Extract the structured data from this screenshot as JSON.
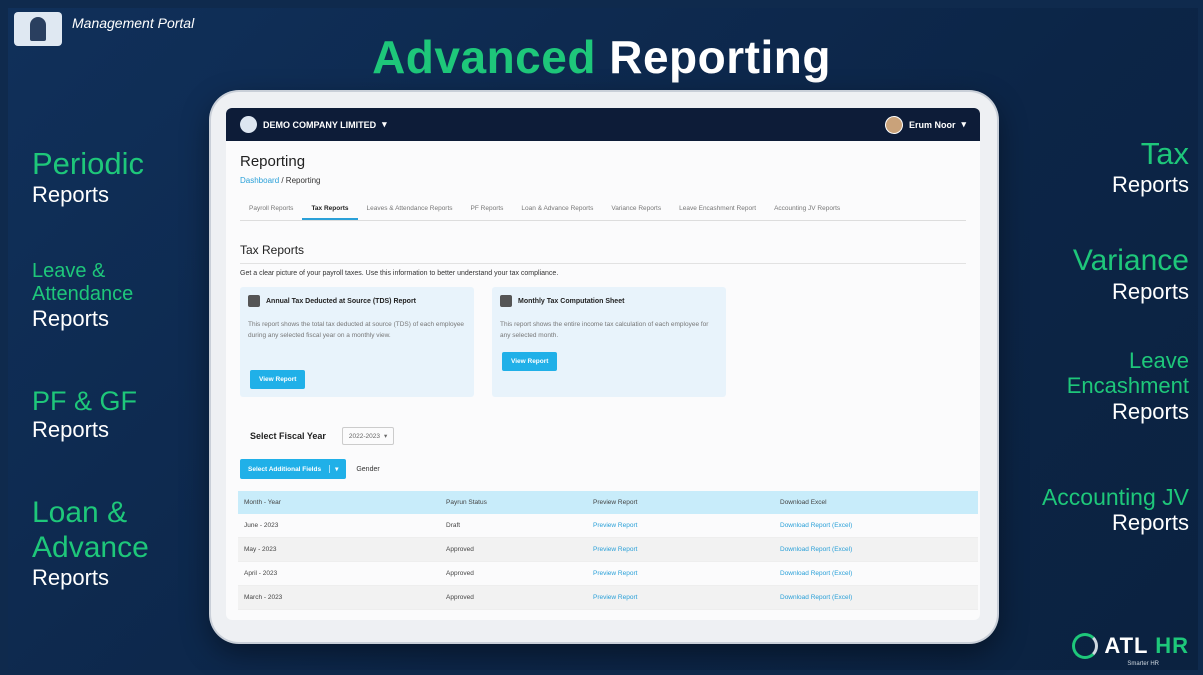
{
  "header": {
    "portal_label": "Management Portal",
    "title_green": "Advanced",
    "title_white": "Reporting"
  },
  "left_labels": [
    {
      "green": "Periodic",
      "white": "Reports"
    },
    {
      "green": "Leave &",
      "green2": "Attendance",
      "white": "Reports"
    },
    {
      "green": "PF & GF",
      "white": "Reports"
    },
    {
      "green": "Loan &",
      "green2": "Advance",
      "white": "Reports"
    }
  ],
  "right_labels": [
    {
      "green": "Tax",
      "white": "Reports"
    },
    {
      "green": "Variance",
      "white": "Reports"
    },
    {
      "green": "Leave",
      "green2": "Encashment",
      "white": "Reports"
    },
    {
      "green": "Accounting JV",
      "white": "Reports"
    }
  ],
  "app": {
    "company": "DEMO COMPANY LIMITED",
    "user": "Erum Noor",
    "page_title": "Reporting",
    "breadcrumb_link": "Dashboard",
    "breadcrumb_current": " / Reporting",
    "tabs": [
      "Payroll Reports",
      "Tax Reports",
      "Leaves & Attendance Reports",
      "PF Reports",
      "Loan & Advance Reports",
      "Variance Reports",
      "Leave Encashment Report",
      "Accounting JV Reports"
    ],
    "active_tab": "Tax Reports",
    "section_title": "Tax Reports",
    "section_desc": "Get a clear picture of your payroll taxes. Use this information to better understand your tax compliance.",
    "cards": [
      {
        "title": "Annual Tax Deducted at Source (TDS) Report",
        "text": "This report shows the total tax deducted at source (TDS) of each employee during any selected fiscal year on a monthly view.",
        "button": "View Report"
      },
      {
        "title": "Monthly Tax Computation Sheet",
        "text": "This report shows the entire income tax calculation of each employee for any selected month.",
        "button": "View Report"
      }
    ],
    "fiscal_label": "Select Fiscal Year",
    "fiscal_value": "2022-2023",
    "add_fields_button": "Select Additional Fields",
    "gender_label": "Gender",
    "table": {
      "headers": [
        "Month - Year",
        "Payrun Status",
        "Preview Report",
        "Download Excel"
      ],
      "rows": [
        [
          "June - 2023",
          "Draft",
          "Preview Report",
          "Download Report (Excel)"
        ],
        [
          "May - 2023",
          "Approved",
          "Preview Report",
          "Download Report (Excel)"
        ],
        [
          "April - 2023",
          "Approved",
          "Preview Report",
          "Download Report (Excel)"
        ],
        [
          "March - 2023",
          "Approved",
          "Preview Report",
          "Download Report (Excel)"
        ]
      ]
    }
  },
  "brand": {
    "name_a": "ATL",
    "name_b": "HR",
    "tagline": "Smarter HR"
  },
  "colors": {
    "accent_green": "#1ec77a",
    "background_navy": "#0f2a4d",
    "app_blue": "#20b0e8"
  }
}
